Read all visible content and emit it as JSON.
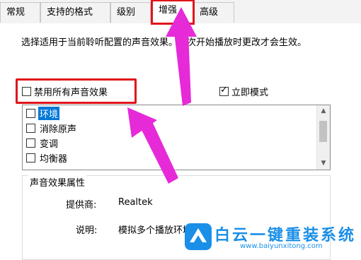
{
  "tabs": [
    {
      "label": "常规"
    },
    {
      "label": "支持的格式"
    },
    {
      "label": "级别"
    },
    {
      "label": "增强"
    },
    {
      "label": "高级"
    }
  ],
  "description": "选择适用于当前聆听配置的声音效果。下次开始播放时更改才会生效。",
  "disable_all": {
    "label": "禁用所有声音效果",
    "checked": false
  },
  "immediate_mode": {
    "label": "立即模式",
    "checked": true
  },
  "effects": [
    {
      "label": "环境",
      "checked": false,
      "selected": true
    },
    {
      "label": "消除原声",
      "checked": false,
      "selected": false
    },
    {
      "label": "变调",
      "checked": false,
      "selected": false
    },
    {
      "label": "均衡器",
      "checked": false,
      "selected": false
    }
  ],
  "properties": {
    "group_title": "声音效果属性",
    "provider_label": "提供商:",
    "provider_value": "Realtek",
    "description_label": "说明:",
    "description_value": "模拟多个播放环境"
  },
  "watermark": {
    "title": "白云一键重装系统",
    "url": "www.baiyunxitong.com"
  },
  "colors": {
    "highlight": "#e0141b",
    "arrow": "#e62ad8",
    "selection": "#0078d7",
    "brand": "#1a8fe8"
  }
}
